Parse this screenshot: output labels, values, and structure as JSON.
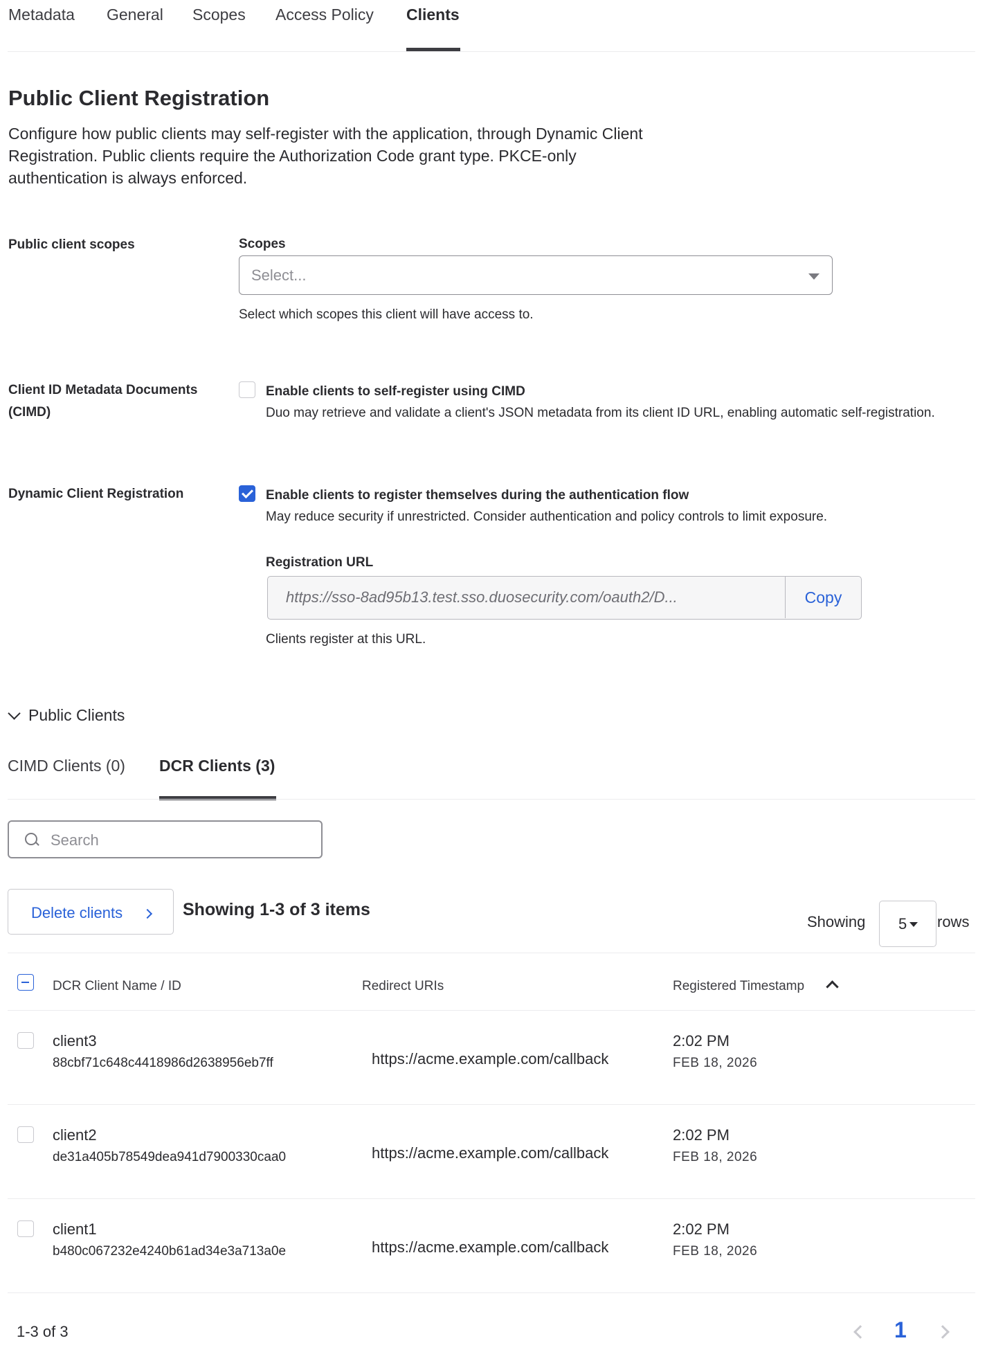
{
  "tabs": [
    {
      "label": "Metadata",
      "active": false
    },
    {
      "label": "General",
      "active": false
    },
    {
      "label": "Scopes",
      "active": false
    },
    {
      "label": "Access Policy",
      "active": false
    },
    {
      "label": "Clients",
      "active": true
    }
  ],
  "section": {
    "title": "Public Client Registration",
    "description": "Configure how public clients may self-register with the application, through Dynamic Client Registration. Public clients require the Authorization Code grant type. PKCE-only authentication is always enforced."
  },
  "scopes_row": {
    "label": "Public client scopes",
    "field_label": "Scopes",
    "placeholder": "Select...",
    "help": "Select which scopes this client will have access to."
  },
  "cimd_row": {
    "label": "Client ID Metadata Documents (CIMD)",
    "checked": false,
    "option_title": "Enable clients to self-register using CIMD",
    "option_desc": "Duo may retrieve and validate a client's JSON metadata from its client ID URL, enabling automatic self-registration."
  },
  "dcr_row": {
    "label": "Dynamic Client Registration",
    "checked": true,
    "option_title": "Enable clients to register themselves during the authentication flow",
    "option_desc": "May reduce security if unrestricted. Consider authentication and policy controls to limit exposure.",
    "url_label": "Registration URL",
    "url_value": "https://sso-8ad95b13.test.sso.duosecurity.com/oauth2/D...",
    "copy_label": "Copy",
    "url_help": "Clients register at this URL."
  },
  "public_clients": {
    "toggle_label": "Public Clients",
    "subtabs": [
      {
        "label": "CIMD Clients (0)",
        "active": false
      },
      {
        "label": "DCR Clients (3)",
        "active": true
      }
    ],
    "search_placeholder": "Search",
    "delete_label": "Delete clients",
    "count_text": "Showing 1-3 of 3 items",
    "rows_prefix": "Showing",
    "rows_value": "5",
    "rows_suffix": "rows",
    "columns": [
      "DCR Client Name / ID",
      "Redirect URIs",
      "Registered Timestamp"
    ],
    "rows": [
      {
        "name": "client3",
        "id": "88cbf71c648c4418986d2638956eb7ff",
        "uri": "https://acme.example.com/callback",
        "time": "2:02 PM",
        "date": "FEB 18, 2026"
      },
      {
        "name": "client2",
        "id": "de31a405b78549dea941d7900330caa0",
        "uri": "https://acme.example.com/callback",
        "time": "2:02 PM",
        "date": "FEB 18, 2026"
      },
      {
        "name": "client1",
        "id": "b480c067232e4240b61ad34e3a713a0e",
        "uri": "https://acme.example.com/callback",
        "time": "2:02 PM",
        "date": "FEB 18, 2026"
      }
    ],
    "footer_range": "1-3 of 3",
    "current_page": "1"
  },
  "colors": {
    "accent": "#2a62d8",
    "text": "#2b2b2f",
    "border": "#c9c9ce"
  },
  "icons": [
    "chevron-down-icon",
    "caret-down-icon",
    "checkbox-icon",
    "search-icon",
    "chevron-right-icon",
    "sort-up-icon",
    "chevron-left-icon"
  ]
}
